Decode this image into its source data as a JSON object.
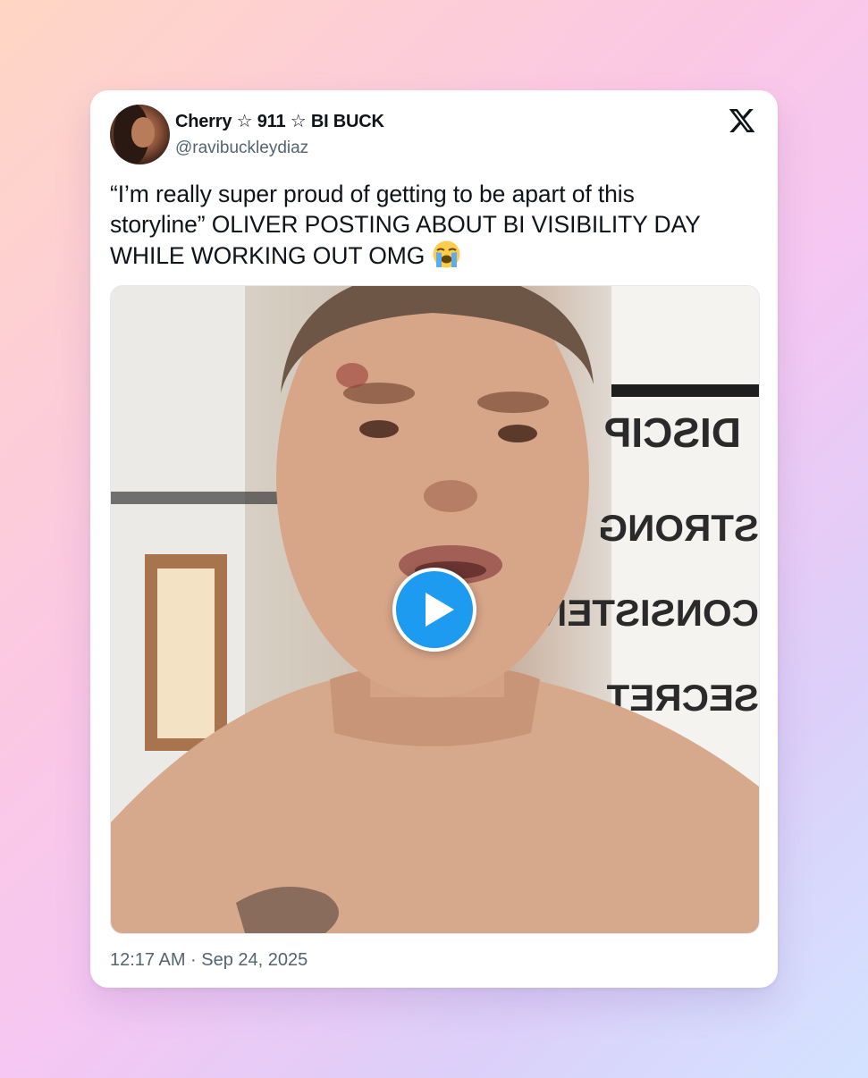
{
  "author": {
    "display_name": "Cherry ☆ 911 ☆ BI BUCK",
    "handle": "@ravibuckleydiaz"
  },
  "tweet": {
    "text": "“I’m really super proud of getting to be apart of this storyline” OLIVER POSTING ABOUT BI VISIBILITY DAY WHILE WORKING OUT OMG",
    "emoji": "loudly-crying-face",
    "timestamp": "12:17 AM · Sep 24, 2025"
  },
  "media": {
    "type": "video",
    "wall_text": [
      "DISCIP",
      "STRONG",
      "CONSISTENC",
      "SECRET"
    ]
  },
  "icons": {
    "brand": "x-logo-icon",
    "play": "play-icon"
  },
  "colors": {
    "accent": "#1d9bf0",
    "text": "#0f1419",
    "muted": "#536471"
  }
}
